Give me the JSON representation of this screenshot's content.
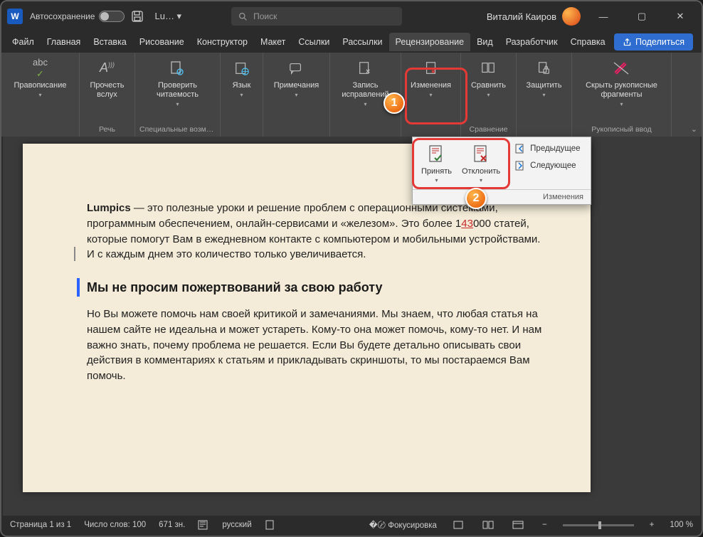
{
  "titlebar": {
    "autosave": "Автосохранение",
    "doc": "Lu…  ▾",
    "search_placeholder": "Поиск",
    "user": "Виталий Каиров"
  },
  "tabs": [
    "Файл",
    "Главная",
    "Вставка",
    "Рисование",
    "Конструктор",
    "Макет",
    "Ссылки",
    "Рассылки",
    "Рецензирование",
    "Вид",
    "Разработчик",
    "Справка"
  ],
  "share": "Поделиться",
  "ribbon": {
    "groups": [
      {
        "label": "",
        "items": [
          {
            "label": "Правописание",
            "caret": true
          }
        ]
      },
      {
        "label": "Речь",
        "items": [
          {
            "label": "Прочесть вслух"
          }
        ]
      },
      {
        "label": "Специальные возмо…",
        "items": [
          {
            "label": "Проверить читаемость",
            "caret": true
          }
        ]
      },
      {
        "label": "",
        "items": [
          {
            "label": "Язык",
            "caret": true
          }
        ]
      },
      {
        "label": "",
        "items": [
          {
            "label": "Примечания",
            "caret": true
          }
        ]
      },
      {
        "label": "",
        "items": [
          {
            "label": "Запись исправлений",
            "caret": true
          }
        ]
      },
      {
        "label": "",
        "items": [
          {
            "label": "Изменения",
            "caret": true
          }
        ]
      },
      {
        "label": "Сравнение",
        "items": [
          {
            "label": "Сравнить",
            "caret": true
          }
        ]
      },
      {
        "label": "",
        "items": [
          {
            "label": "Защитить",
            "caret": true
          }
        ]
      },
      {
        "label": "Рукописный ввод",
        "items": [
          {
            "label": "Скрыть рукописные фрагменты",
            "caret": true
          }
        ]
      }
    ]
  },
  "dropdown": {
    "accept": "Принять",
    "reject": "Отклонить",
    "prev": "Предыдущее",
    "next": "Следующее",
    "footer": "Изменения"
  },
  "doc": {
    "p1a": "Lumpics",
    "p1b": " — это полезные уроки и решение проблем с операционными системами, программным обеспечением, онлайн-сервисами и «железом». Это более 1",
    "p1c": "43",
    "p1d": "000 статей, которые помогут Вам в ежедневном контакте с компьютером и мобильными устройствами. И с каждым днем это количество только увеличивается.",
    "h2": "Мы не просим пожертвований за свою работу",
    "p2": "Но Вы можете помочь нам своей критикой и замечаниями. Мы знаем, что любая статья на нашем сайте не идеальна и может устареть. Кому-то она может помочь, кому-то нет. И нам важно знать, почему проблема не решается. Если Вы будете детально описывать свои действия в комментариях к статьям и прикладывать скриншоты, то мы постараемся Вам помочь."
  },
  "status": {
    "page": "Страница 1 из 1",
    "words": "Число слов: 100",
    "chars": "671 зн.",
    "lang": "русский",
    "focus": "Фокусировка",
    "zoom": "100 %"
  }
}
